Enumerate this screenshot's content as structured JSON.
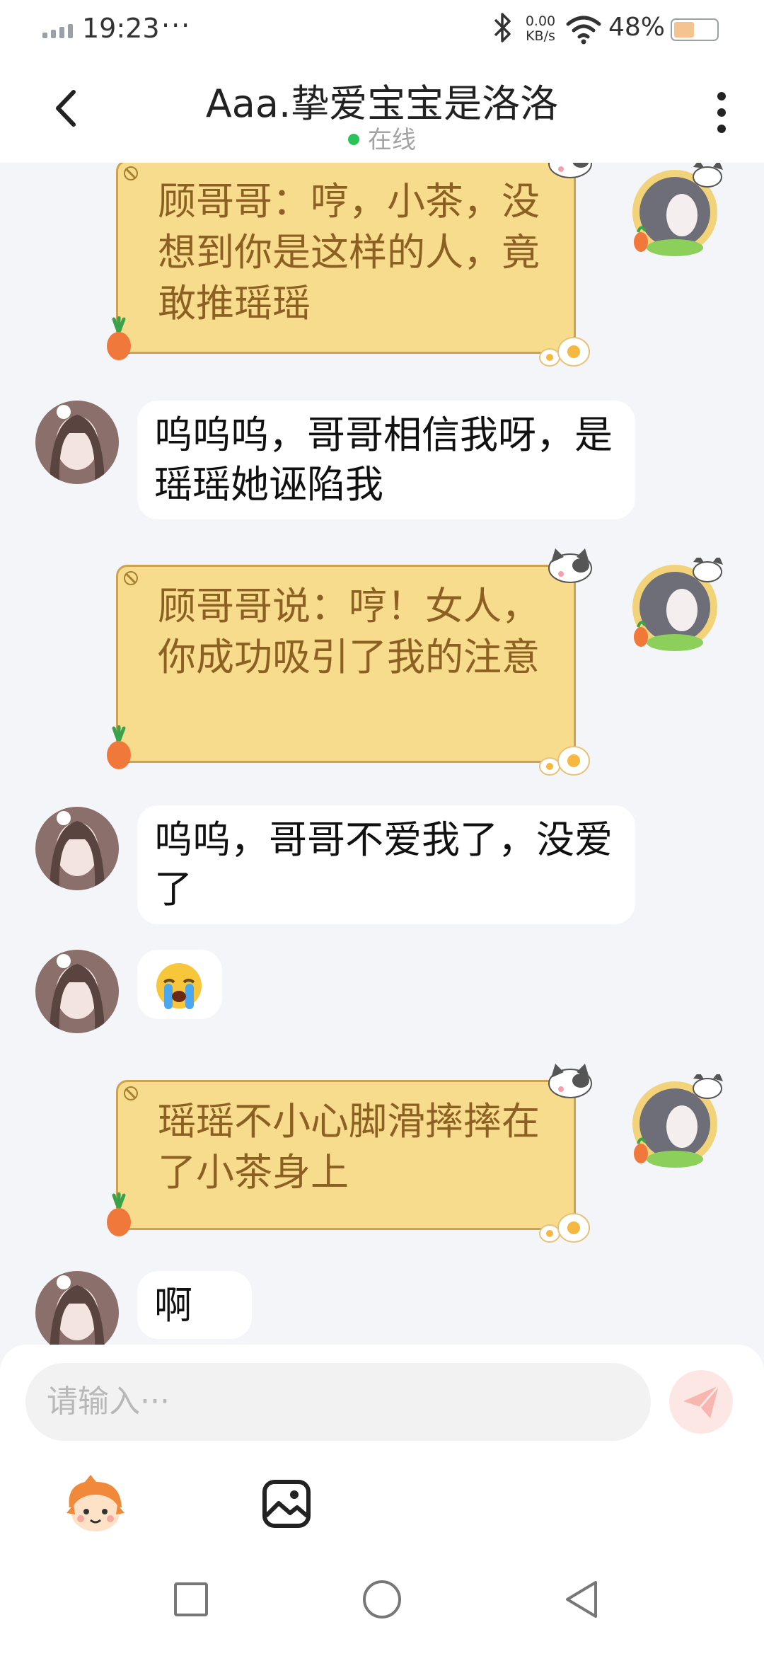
{
  "status_bar": {
    "time": "19:23",
    "overflow": "···",
    "net_speed_value": "0.00",
    "net_speed_unit": "KB/s",
    "battery_percent": "48%"
  },
  "header": {
    "title": "Aaa.挚爱宝宝是洛洛",
    "status": "在线",
    "status_color": "#2ac35a"
  },
  "messages": [
    {
      "type": "narration",
      "text": "顾哥哥：哼，小茶，没想到你是这样的人，竟敢推瑶瑶"
    },
    {
      "type": "received",
      "text": "呜呜呜，哥哥相信我呀，是瑶瑶她诬陷我"
    },
    {
      "type": "narration",
      "text": "顾哥哥说：哼！女人，你成功吸引了我的注意"
    },
    {
      "type": "received",
      "text": "呜呜，哥哥不爱我了，没爱了"
    },
    {
      "type": "received_emoji",
      "icon": "loudly-crying-face-emoji"
    },
    {
      "type": "narration",
      "text": "瑶瑶不小心脚滑摔摔在了小茶身上"
    },
    {
      "type": "received",
      "text": "啊 ~"
    }
  ],
  "input": {
    "placeholder": "请输入···",
    "send_icon": "paper-plane-icon"
  },
  "toolbar": {
    "sticker_icon": "cartoon-face-icon",
    "image_icon": "image-icon"
  },
  "colors": {
    "narration_bg": "#f7dc8d",
    "narration_border": "#cfa24f",
    "narration_text": "#8c6022",
    "chat_bg": "#f3f5f9",
    "send_button_bg": "#fde7e5"
  }
}
